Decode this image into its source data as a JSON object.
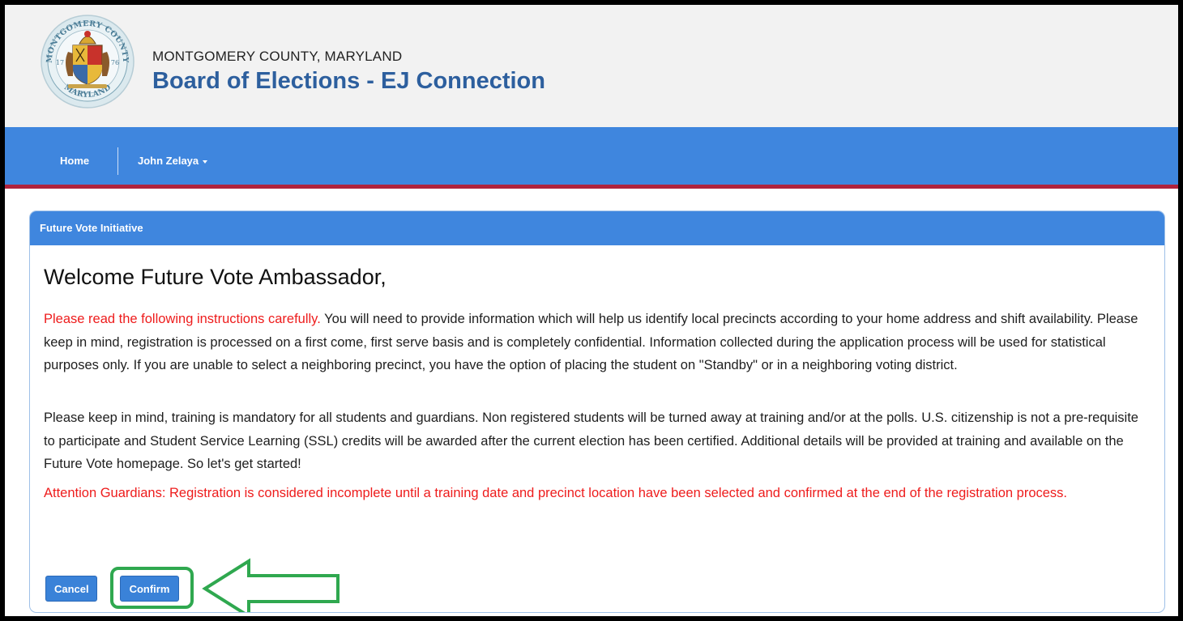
{
  "header": {
    "seal_icon": "montgomery-county-seal-icon",
    "seal_text": {
      "top": "MONTGOMERY COUNTY",
      "bottom": "MARYLAND",
      "year_left": "17",
      "year_right": "76"
    },
    "county": "MONTGOMERY COUNTY, MARYLAND",
    "title": "Board of Elections - EJ Connection"
  },
  "nav": {
    "home": "Home",
    "user": "John Zelaya",
    "user_caret_icon": "caret-down-icon"
  },
  "panel": {
    "heading": "Future Vote Initiative",
    "welcome": "Welcome Future Vote Ambassador,",
    "para1_red": "Please read the following instructions carefully.",
    "para1_rest": " You will need to provide information which will help us identify local precincts according to your home address and shift availability. Please keep in mind, registration is processed on a first come, first serve basis and is completely confidential. Information collected during the application process will be used for statistical purposes only. If you are unable to select a neighboring precinct, you have the option of placing the student on \"Standby\" or in a neighboring voting district.",
    "para2": "Please keep in mind, training is mandatory for all students and guardians. Non registered students will be turned away at training and/or at the polls. U.S. citizenship is not a pre-requisite to participate and Student Service Learning (SSL) credits will be awarded after the current election has been certified. Additional details will be provided at training and available on the Future Vote homepage. So let's get started!",
    "para3": "Attention Guardians: Registration is considered incomplete until a training date and precinct location have been selected and confirmed at the end of the registration process."
  },
  "buttons": {
    "cancel": "Cancel",
    "confirm": "Confirm"
  },
  "annotation": {
    "arrow_icon": "left-arrow-icon",
    "color": "#2fa84f"
  },
  "colors": {
    "nav_blue": "#3f86de",
    "title_blue": "#2d5f9e",
    "accent_red": "#ee1c1c",
    "nav_border": "#b0233c"
  }
}
